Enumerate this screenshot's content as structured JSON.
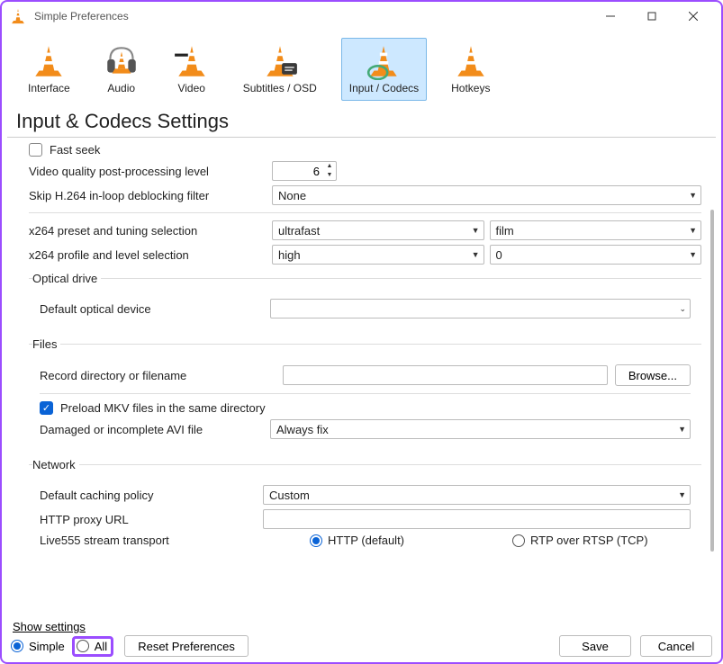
{
  "window": {
    "title": "Simple Preferences"
  },
  "tabs": {
    "items": [
      {
        "label": "Interface"
      },
      {
        "label": "Audio"
      },
      {
        "label": "Video"
      },
      {
        "label": "Subtitles / OSD"
      },
      {
        "label": "Input / Codecs",
        "selected": true
      },
      {
        "label": "Hotkeys"
      }
    ]
  },
  "heading": "Input & Codecs Settings",
  "codecs": {
    "fast_seek_label": "Fast seek",
    "fast_seek_checked": false,
    "vq_label": "Video quality post-processing level",
    "vq_value": "6",
    "skip_label": "Skip H.264 in-loop deblocking filter",
    "skip_value": "None",
    "x264_preset_label": "x264 preset and tuning selection",
    "x264_preset_value": "ultrafast",
    "x264_tune_value": "film",
    "x264_profile_label": "x264 profile and level selection",
    "x264_profile_value": "high",
    "x264_level_value": "0"
  },
  "optical": {
    "legend": "Optical drive",
    "default_label": "Default optical device",
    "default_value": ""
  },
  "files": {
    "legend": "Files",
    "record_label": "Record directory or filename",
    "record_value": "",
    "browse_label": "Browse...",
    "preload_label": "Preload MKV files in the same directory",
    "preload_checked": true,
    "avi_label": "Damaged or incomplete AVI file",
    "avi_value": "Always fix"
  },
  "network": {
    "legend": "Network",
    "caching_label": "Default caching policy",
    "caching_value": "Custom",
    "proxy_label": "HTTP proxy URL",
    "proxy_value": "",
    "live555_label": "Live555 stream transport",
    "live555_http": "HTTP (default)",
    "live555_rtp": "RTP over RTSP (TCP)"
  },
  "footer": {
    "show_settings": "Show settings",
    "simple": "Simple",
    "all": "All",
    "reset": "Reset Preferences",
    "save": "Save",
    "cancel": "Cancel"
  }
}
